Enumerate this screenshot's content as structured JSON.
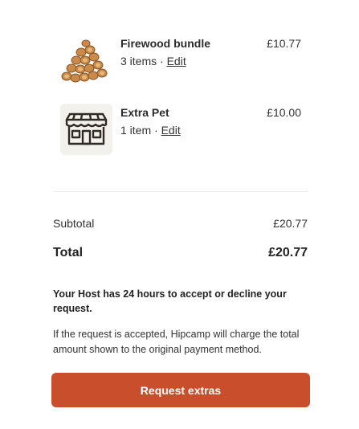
{
  "items": [
    {
      "name": "Firewood bundle",
      "meta": "3 items · ",
      "edit_label": "Edit",
      "price": "£10.77",
      "icon": "firewood-icon"
    },
    {
      "name": "Extra Pet",
      "meta": "1 item · ",
      "edit_label": "Edit",
      "price": "£10.00",
      "icon": "storefront-icon"
    }
  ],
  "summary": {
    "subtotal_label": "Subtotal",
    "subtotal_value": "£20.77",
    "total_label": "Total",
    "total_value": "£20.77"
  },
  "notice": {
    "bold": "Your Host has 24 hours to accept or decline your request.",
    "text": "If the request is accepted, Hipcamp will charge the total amount shown to the original payment method."
  },
  "button": {
    "label": "Request extras"
  },
  "colors": {
    "button": "#c94f2c",
    "thumb_background": "#f3f1ec"
  }
}
